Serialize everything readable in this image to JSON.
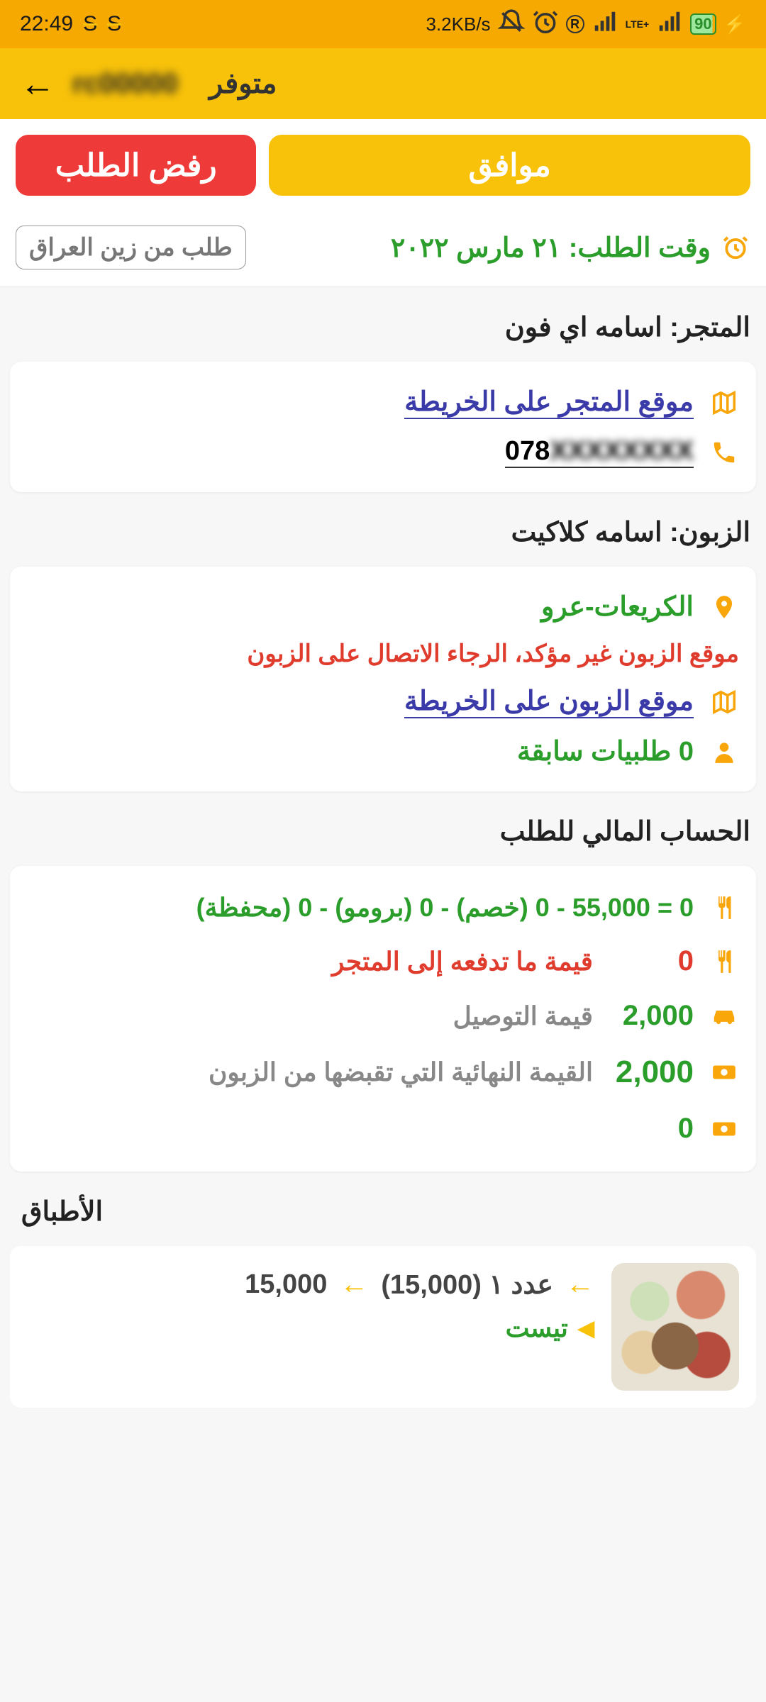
{
  "status_bar": {
    "time": "22:49",
    "net_speed": "3.2KB/s",
    "battery": "90"
  },
  "app_bar": {
    "driver_id": "rc00000",
    "availability": "متوفر"
  },
  "buttons": {
    "accept": "موافق",
    "reject": "رفض الطلب"
  },
  "order_time": {
    "label": "وقت الطلب: ٢١ مارس ٢٠٢٢",
    "zain": "طلب من زين العراق"
  },
  "store": {
    "heading": "المتجر: اسامه اي فون",
    "map_link": "موقع المتجر على الخريطة",
    "phone_prefix": "078",
    "phone_hidden": "XXXXXXXX"
  },
  "customer": {
    "heading": "الزبون: اسامه كلاكيت",
    "address": "الكريعات-عرو",
    "warning": "موقع الزبون غير مؤكد، الرجاء الاتصال على الزبون",
    "map_link": "موقع الزبون على الخريطة",
    "prev_orders": "0 طلبيات سابقة"
  },
  "finance": {
    "heading": "الحساب المالي للطلب",
    "line1_value": "",
    "line1_label": "0 = 55,000 - 0 (خصم) - 0 (برومو) - 0 (محفظة)",
    "line2_value": "0",
    "line2_label": "قيمة ما تدفعه إلى المتجر",
    "line3_value": "2,000",
    "line3_label": "قيمة التوصيل",
    "line4_value": "2,000",
    "line4_label": "القيمة النهائية التي تقبضها من الزبون",
    "line5_value": "0"
  },
  "dishes": {
    "heading": "الأطباق",
    "item": {
      "qty_price": "عدد ١ (15,000)",
      "total": "15,000",
      "name": "تيست"
    }
  }
}
